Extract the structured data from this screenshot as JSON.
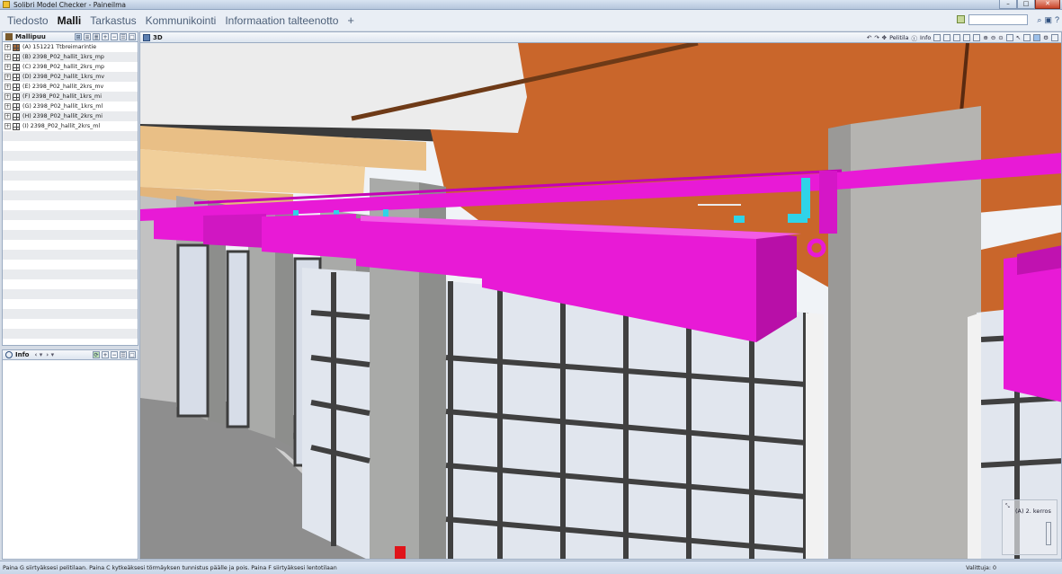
{
  "window": {
    "title": "Solibri Model Checker - Paineilma"
  },
  "menu": {
    "items": [
      {
        "label": "Tiedosto",
        "active": false
      },
      {
        "label": "Malli",
        "active": true
      },
      {
        "label": "Tarkastus",
        "active": false
      },
      {
        "label": "Kommunikointi",
        "active": false
      },
      {
        "label": "Informaation talteenotto",
        "active": false
      }
    ],
    "add_label": "+"
  },
  "model_tree": {
    "title": "Mallipuu",
    "items": [
      {
        "label": "(A) 151221 Ttbreimarintie",
        "icon": "building-model-icon"
      },
      {
        "label": "(B) 2398_P02_hallit_1krs_mp",
        "icon": "ifc-model-icon"
      },
      {
        "label": "(C) 2398_P02_hallit_2krs_mp",
        "icon": "ifc-model-icon"
      },
      {
        "label": "(D) 2398_P02_hallit_1krs_mv",
        "icon": "ifc-model-icon"
      },
      {
        "label": "(E) 2398_P02_hallit_2krs_mv",
        "icon": "ifc-model-icon"
      },
      {
        "label": "(F) 2398_P02_hallit_1krs_mi",
        "icon": "ifc-model-icon"
      },
      {
        "label": "(G) 2398_P02_hallit_1krs_ml",
        "icon": "ifc-model-icon"
      },
      {
        "label": "(H) 2398_P02_hallit_2krs_mi",
        "icon": "ifc-model-icon"
      },
      {
        "label": "(I) 2398_P02_hallit_2krs_ml",
        "icon": "ifc-model-icon"
      }
    ]
  },
  "info_panel": {
    "title": "Info"
  },
  "viewport": {
    "title": "3D",
    "tools": {
      "walk_label": "Pelitila",
      "info_label": "Info"
    },
    "minimap": {
      "floor_label": "(A) 2. kerros"
    }
  },
  "status": {
    "hint": "Paina G siirtyäksesi pelitilaan. Paina C kytkeäksesi törmäyksen tunnistus päälle ja pois. Paina F siirtyäksesi lentotilaan",
    "selected": "Valittuja: 0"
  },
  "colors": {
    "duct": "#e81ad6",
    "pipe_cyan": "#2fd3e8",
    "wall_orange": "#c9662b",
    "ceiling": "#e9bf86"
  }
}
